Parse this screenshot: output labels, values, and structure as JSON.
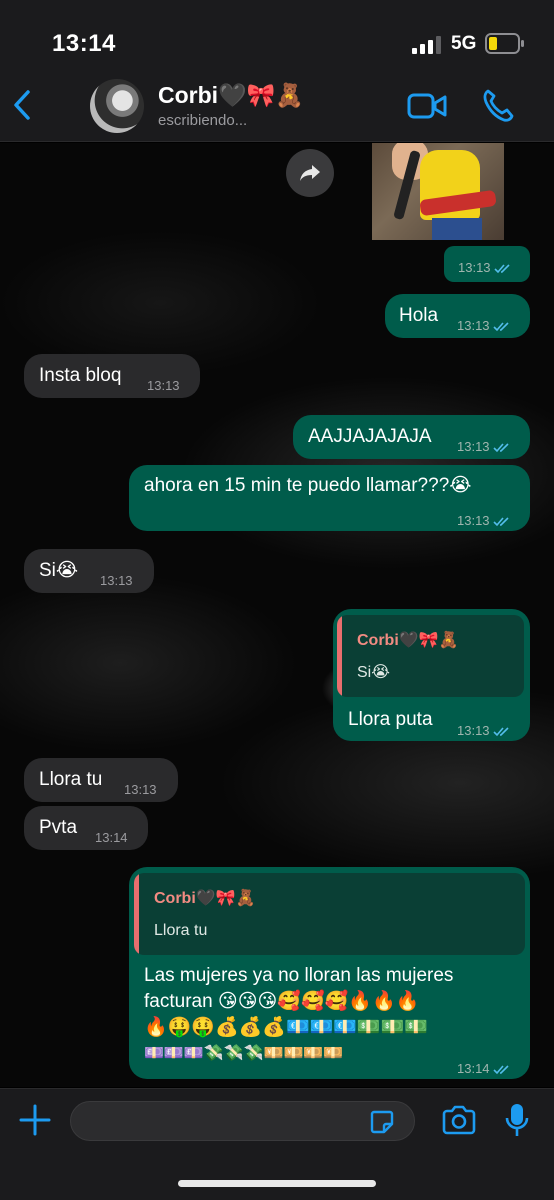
{
  "status_bar": {
    "time": "13:14",
    "network": "5G"
  },
  "header": {
    "contact_name": "Corbi🖤🎀🧸",
    "contact_status": "escribiendo..."
  },
  "messages": [
    {
      "id": "m1",
      "from": "me",
      "text": "",
      "time": "13:13"
    },
    {
      "id": "m2",
      "from": "me",
      "text": "Hola",
      "time": "13:13"
    },
    {
      "id": "m3",
      "from": "them",
      "text": "Insta bloq",
      "time": "13:13"
    },
    {
      "id": "m4",
      "from": "me",
      "text": "AAJJAJAJAJA",
      "time": "13:13"
    },
    {
      "id": "m5",
      "from": "me",
      "text": "ahora en 15 min te puedo llamar???😭",
      "time": "13:13"
    },
    {
      "id": "m6",
      "from": "them",
      "text": "Si😭",
      "time": "13:13"
    },
    {
      "id": "m7",
      "from": "me",
      "quote_name": "Corbi🖤🎀🧸",
      "quote_text": "Si😭",
      "text": "Llora puta",
      "time": "13:13"
    },
    {
      "id": "m8",
      "from": "them",
      "text": "Llora tu",
      "time": "13:13"
    },
    {
      "id": "m9",
      "from": "them",
      "text": "Pvta",
      "time": "13:14"
    },
    {
      "id": "m10",
      "from": "me",
      "quote_name": "Corbi🖤🎀🧸",
      "quote_text": "Llora tu",
      "lines": [
        "Las mujeres ya no lloran las mujeres",
        "facturan 😘😘😘🥰🥰🥰🔥🔥🔥",
        "🔥🤑🤑💰💰💰💶💶💶💵💵💵",
        "💷💷💷💸💸💸💴💴💴💴"
      ],
      "time": "13:14"
    }
  ],
  "composer": {
    "placeholder": ""
  },
  "colors": {
    "accent": "#1d9bf0",
    "outgoing": "#005c4b",
    "incoming": "#2a2a2c",
    "read_tick": "#53bdeb",
    "quote_bar": "#e86e6e"
  },
  "icons": [
    "back-chevron-icon",
    "video-call-icon",
    "phone-call-icon",
    "forward-icon",
    "double-check-icon",
    "plus-icon",
    "sticker-icon",
    "camera-icon",
    "microphone-icon"
  ]
}
